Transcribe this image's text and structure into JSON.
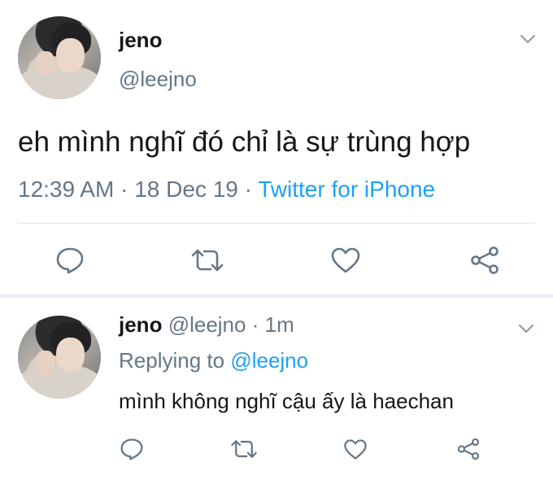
{
  "main_tweet": {
    "display_name": "jeno",
    "handle": "@leejno",
    "text": "eh mình nghĩ đó chỉ là sự trùng hợp",
    "time": "12:39 AM",
    "separator1": "·",
    "date": "18 Dec 19",
    "separator2": "·",
    "source": "Twitter for iPhone"
  },
  "reply": {
    "display_name": "jeno",
    "handle": "@leejno",
    "separator": "·",
    "time_ago": "1m",
    "replying_prefix": "Replying to",
    "replying_to": "@leejno",
    "text": "mình không nghĩ cậu ấy là haechan"
  },
  "icons": {
    "menu": "chevron-down-icon",
    "reply": "speech-bubble-icon",
    "retweet": "retweet-icon",
    "like": "heart-icon",
    "share": "share-icon"
  },
  "colors": {
    "text": "#14171a",
    "muted": "#657786",
    "link": "#1da1f2",
    "divider": "#e1e8ed",
    "icon": "#657786"
  }
}
